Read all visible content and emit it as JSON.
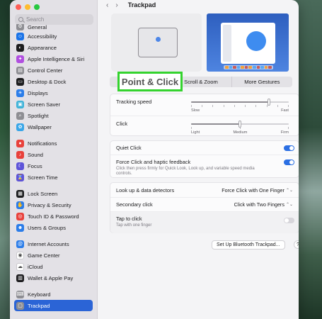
{
  "window": {
    "title": "Trackpad"
  },
  "sidebar": {
    "search_placeholder": "Search",
    "items": [
      {
        "label": "General",
        "icon": "gear-icon",
        "color": "#8e8e93",
        "glyph": "⚙"
      },
      {
        "label": "Accessibility",
        "icon": "accessibility-icon",
        "color": "#1a73e8",
        "glyph": "☺"
      },
      {
        "label": "Appearance",
        "icon": "appearance-icon",
        "color": "#1d1d1f",
        "glyph": "◐"
      },
      {
        "label": "Apple Intelligence & Siri",
        "icon": "siri-icon",
        "color": "#b14fe0",
        "glyph": "✦"
      },
      {
        "label": "Control Center",
        "icon": "control-center-icon",
        "color": "#8e8e93",
        "glyph": "▤"
      },
      {
        "label": "Desktop & Dock",
        "icon": "dock-icon",
        "color": "#1d1d1f",
        "glyph": "▭"
      },
      {
        "label": "Displays",
        "icon": "displays-icon",
        "color": "#2b7de9",
        "glyph": "☀"
      },
      {
        "label": "Screen Saver",
        "icon": "screen-saver-icon",
        "color": "#3fb3d8",
        "glyph": "▣"
      },
      {
        "label": "Spotlight",
        "icon": "spotlight-icon",
        "color": "#8e8e93",
        "glyph": "⌕"
      },
      {
        "label": "Wallpaper",
        "icon": "wallpaper-icon",
        "color": "#39a6e8",
        "glyph": "✿"
      },
      {
        "label": "Notifications",
        "icon": "notifications-icon",
        "color": "#e8413b",
        "glyph": "●"
      },
      {
        "label": "Sound",
        "icon": "sound-icon",
        "color": "#e8413b",
        "glyph": "♪"
      },
      {
        "label": "Focus",
        "icon": "focus-icon",
        "color": "#5e54d9",
        "glyph": "☾"
      },
      {
        "label": "Screen Time",
        "icon": "screen-time-icon",
        "color": "#5e54d9",
        "glyph": "⌛"
      },
      {
        "label": "Lock Screen",
        "icon": "lock-screen-icon",
        "color": "#1d1d1f",
        "glyph": "▦"
      },
      {
        "label": "Privacy & Security",
        "icon": "privacy-icon",
        "color": "#2b7de9",
        "glyph": "✋"
      },
      {
        "label": "Touch ID & Password",
        "icon": "touch-id-icon",
        "color": "#e8413b",
        "glyph": "◎"
      },
      {
        "label": "Users & Groups",
        "icon": "users-icon",
        "color": "#2b7de9",
        "glyph": "☻"
      },
      {
        "label": "Internet Accounts",
        "icon": "internet-accounts-icon",
        "color": "#2b7de9",
        "glyph": "@"
      },
      {
        "label": "Game Center",
        "icon": "game-center-icon",
        "color": "#ffffff",
        "glyph": "◉"
      },
      {
        "label": "iCloud",
        "icon": "icloud-icon",
        "color": "#ffffff",
        "glyph": "☁"
      },
      {
        "label": "Wallet & Apple Pay",
        "icon": "wallet-icon",
        "color": "#1d1d1f",
        "glyph": "▥"
      },
      {
        "label": "Keyboard",
        "icon": "keyboard-icon",
        "color": "#8e8e93",
        "glyph": "⌨"
      },
      {
        "label": "Trackpad",
        "icon": "trackpad-icon",
        "color": "#8e8e93",
        "glyph": "▢",
        "selected": true
      }
    ]
  },
  "tabs": {
    "point_click": "Point & Click",
    "scroll_zoom": "Scroll & Zoom",
    "more_gestures": "More Gestures"
  },
  "settings": {
    "tracking_speed": {
      "label": "Tracking speed",
      "min": "Slow",
      "max": "Fast",
      "value": 0.8
    },
    "click": {
      "label": "Click",
      "min": "Light",
      "mid": "Medium",
      "max": "Firm",
      "value": 0.5
    },
    "quiet_click": {
      "label": "Quiet Click",
      "on": true
    },
    "force_click": {
      "label": "Force Click and haptic feedback",
      "description": "Click then press firmly for Quick Look, Look up, and variable speed media controls.",
      "on": true
    },
    "look_up": {
      "label": "Look up & data detectors",
      "value": "Force Click with One Finger"
    },
    "secondary_click": {
      "label": "Secondary click",
      "value": "Click with Two Fingers"
    },
    "tap_to_click": {
      "label": "Tap to click",
      "description": "Tap with one finger",
      "on": false
    }
  },
  "buttons": {
    "bluetooth": "Set Up Bluetooth Trackpad...",
    "help": "?"
  },
  "colors": {
    "accent": "#2b6fe3",
    "highlight_border": "#34d32e"
  }
}
